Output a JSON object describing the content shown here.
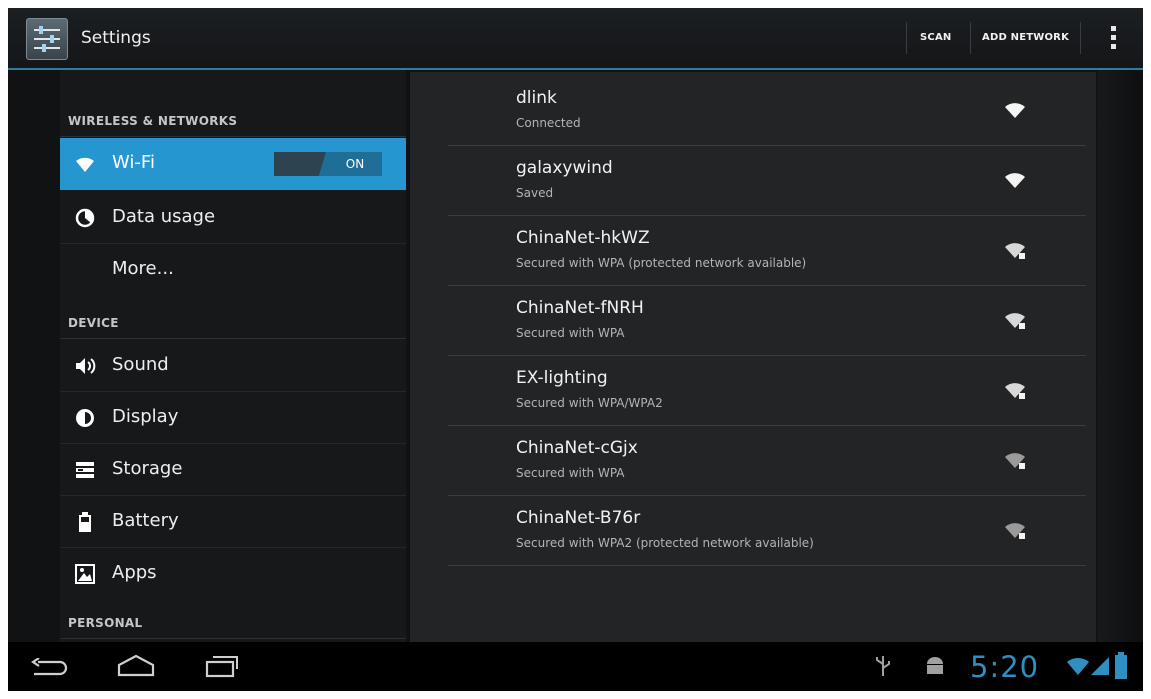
{
  "action_bar": {
    "title": "Settings",
    "scan_label": "SCAN",
    "add_network_label": "ADD NETWORK"
  },
  "sidebar": {
    "sections": [
      {
        "header": "WIRELESS & NETWORKS"
      },
      {
        "header": "DEVICE"
      },
      {
        "header": "PERSONAL"
      }
    ],
    "items": [
      {
        "label": "Wi-Fi",
        "icon": "wifi-icon",
        "selected": true
      },
      {
        "label": "Data usage",
        "icon": "data-usage-icon"
      },
      {
        "label": "More..."
      },
      {
        "label": "Sound",
        "icon": "sound-icon"
      },
      {
        "label": "Display",
        "icon": "display-icon"
      },
      {
        "label": "Storage",
        "icon": "storage-icon"
      },
      {
        "label": "Battery",
        "icon": "battery-icon"
      },
      {
        "label": "Apps",
        "icon": "apps-icon"
      }
    ],
    "wifi_toggle_label": "ON"
  },
  "networks": [
    {
      "name": "dlink",
      "status": "Connected",
      "secured": false
    },
    {
      "name": "galaxywind",
      "status": "Saved",
      "secured": false
    },
    {
      "name": "ChinaNet-hkWZ",
      "status": "Secured with WPA (protected network available)",
      "secured": true
    },
    {
      "name": "ChinaNet-fNRH",
      "status": "Secured with WPA",
      "secured": true
    },
    {
      "name": "EX-lighting",
      "status": "Secured with WPA/WPA2",
      "secured": true
    },
    {
      "name": "ChinaNet-cGjx",
      "status": "Secured with WPA",
      "secured": true
    },
    {
      "name": "ChinaNet-B76r",
      "status": "Secured with WPA2 (protected network available)",
      "secured": true
    }
  ],
  "system_bar": {
    "time": "5:20",
    "icons": [
      "back-icon",
      "home-icon",
      "recent-apps-icon",
      "usb-icon",
      "android-debug-icon",
      "wifi-signal-icon",
      "cell-signal-icon",
      "battery-icon"
    ],
    "accent_color": "#2f8fc2"
  },
  "colors": {
    "accent": "#2596cf",
    "background": "#101214",
    "panel": "#222426"
  }
}
